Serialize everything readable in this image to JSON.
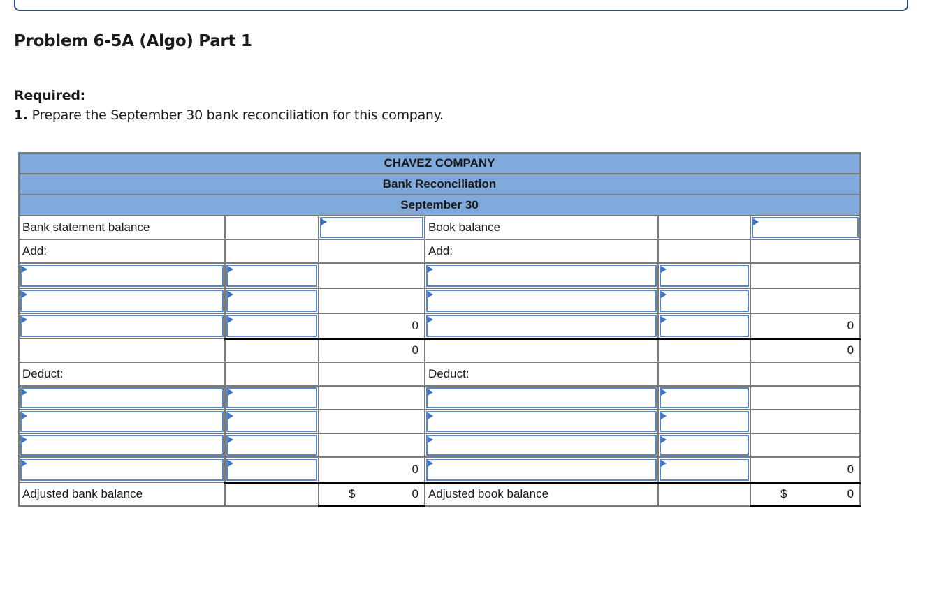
{
  "page": {
    "title": "Problem 6-5A (Algo) Part 1",
    "required_label": "Required:",
    "instruction_number": "1.",
    "instruction_text": " Prepare the September 30 bank reconciliation for this company."
  },
  "reconciliation": {
    "company": "CHAVEZ COMPANY",
    "statement": "Bank Reconciliation",
    "date": "September 30",
    "bank_side": {
      "balance_label": "Bank statement balance",
      "balance_value": "",
      "add_label": "Add:",
      "add_rows": [
        {
          "description": "",
          "amount": ""
        },
        {
          "description": "",
          "amount": ""
        },
        {
          "description": "",
          "amount": ""
        }
      ],
      "add_total": "0",
      "subtotal": "0",
      "deduct_label": "Deduct:",
      "deduct_rows": [
        {
          "description": "",
          "amount": ""
        },
        {
          "description": "",
          "amount": ""
        },
        {
          "description": "",
          "amount": ""
        },
        {
          "description": "",
          "amount": ""
        }
      ],
      "deduct_total": "0",
      "adjusted_label": "Adjusted bank balance",
      "adjusted_currency": "$",
      "adjusted_value": "0"
    },
    "book_side": {
      "balance_label": "Book balance",
      "balance_value": "",
      "add_label": "Add:",
      "add_rows": [
        {
          "description": "",
          "amount": ""
        },
        {
          "description": "",
          "amount": ""
        },
        {
          "description": "",
          "amount": ""
        }
      ],
      "add_total": "0",
      "subtotal": "0",
      "deduct_label": "Deduct:",
      "deduct_rows": [
        {
          "description": "",
          "amount": ""
        },
        {
          "description": "",
          "amount": ""
        },
        {
          "description": "",
          "amount": ""
        },
        {
          "description": "",
          "amount": ""
        }
      ],
      "deduct_total": "0",
      "adjusted_label": "Adjusted book balance",
      "adjusted_currency": "$",
      "adjusted_value": "0"
    }
  },
  "colors": {
    "header_fill": "#80a9dc",
    "input_border": "#5b86c4",
    "input_marker": "#3f74c1",
    "frame_border": "#2c4c7e"
  }
}
